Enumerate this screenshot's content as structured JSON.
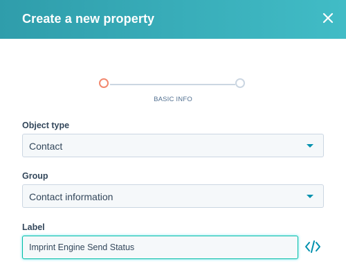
{
  "header": {
    "title": "Create a new property",
    "close_icon": "close-icon",
    "gradient_start": "#2f9dab",
    "gradient_end": "#41bcc6"
  },
  "stepper": {
    "steps": [
      {
        "label": "BASIC INFO",
        "state": "active",
        "color": "#f2886e"
      },
      {
        "label": "",
        "state": "inactive",
        "color": "#cbd6e2"
      }
    ]
  },
  "form": {
    "object_type": {
      "label": "Object type",
      "value": "Contact"
    },
    "group": {
      "label": "Group",
      "value": "Contact information"
    },
    "label_field": {
      "label": "Label",
      "value": "Imprint Engine Send Status"
    },
    "code_icon": "code-icon",
    "accent_color": "#0091ae"
  }
}
